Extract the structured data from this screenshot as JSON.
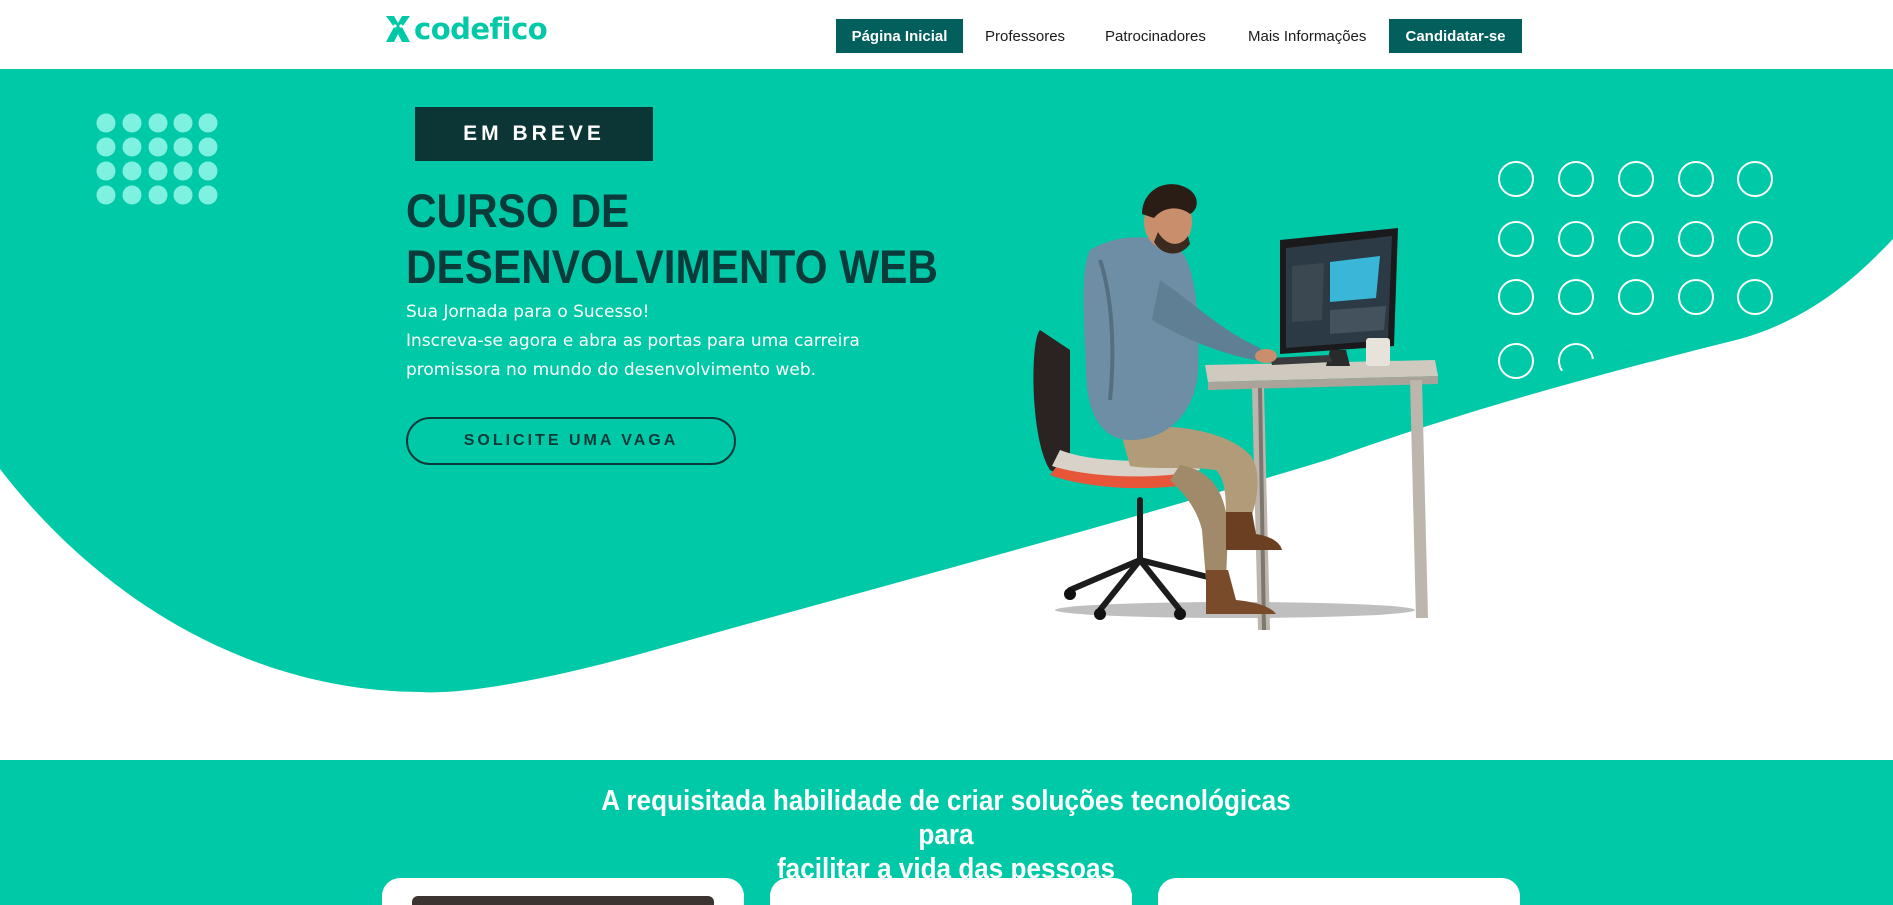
{
  "brand": {
    "name": "codefico",
    "accent": "#00c9a7",
    "dark": "#025f5c",
    "ink": "#0a3a3a"
  },
  "nav": {
    "items": [
      "Página Inicial",
      "Professores",
      "Patrocinadores",
      "Mais Informações"
    ],
    "cta": "Candidatar-se"
  },
  "hero": {
    "badge": "EM BREVE",
    "title_lines": [
      "CURSO DE",
      "DESENVOLVIMENTO WEB"
    ],
    "subtitle_lines": [
      "Sua Jornada para o Sucesso!",
      "Inscreva-se agora e abra as portas para uma carreira",
      "promissora no mundo do desenvolvimento web."
    ],
    "button": "SOLICITE UMA VAGA"
  },
  "feature": {
    "title_lines": [
      "A requisitada habilidade de criar soluções tecnológicas para",
      "facilitar a vida das pessoas"
    ],
    "card_count": 3
  }
}
